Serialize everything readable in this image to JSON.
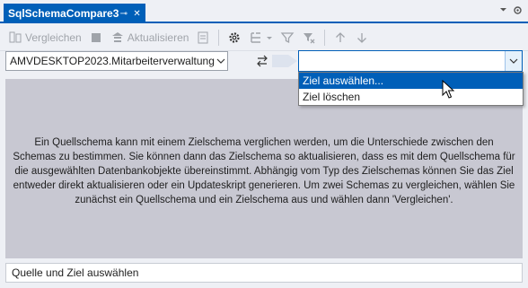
{
  "tab": {
    "title": "SqlSchemaCompare3",
    "pin_glyph": "⊸",
    "close_glyph": "✕"
  },
  "toolbar": {
    "compare_label": "Vergleichen",
    "update_label": "Aktualisieren"
  },
  "source": {
    "value": "AMVDESKTOP2023.Mitarbeiterverwaltung"
  },
  "target": {
    "value": "",
    "options": [
      "Ziel auswählen...",
      "Ziel löschen"
    ],
    "highlighted_index": 0
  },
  "main": {
    "info_text": "Ein Quellschema kann mit einem Zielschema verglichen werden, um die Unterschiede zwischen den Schemas zu bestimmen. Sie können dann das Zielschema so aktualisieren, dass es mit dem Quellschema für die ausgewählten Datenbankobjekte übereinstimmt. Abhängig vom Typ des Zielschemas können Sie das Ziel entweder direkt aktualisieren oder ein Updateskript generieren. Um zwei Schemas zu vergleichen, wählen Sie zunächst ein Quellschema und ein Zielschema aus und wählen dann 'Vergleichen'."
  },
  "status": {
    "text": "Quelle und Ziel auswählen"
  },
  "colors": {
    "accent": "#005fb8",
    "panel": "#c8c8d2",
    "background": "#eef0f5"
  }
}
